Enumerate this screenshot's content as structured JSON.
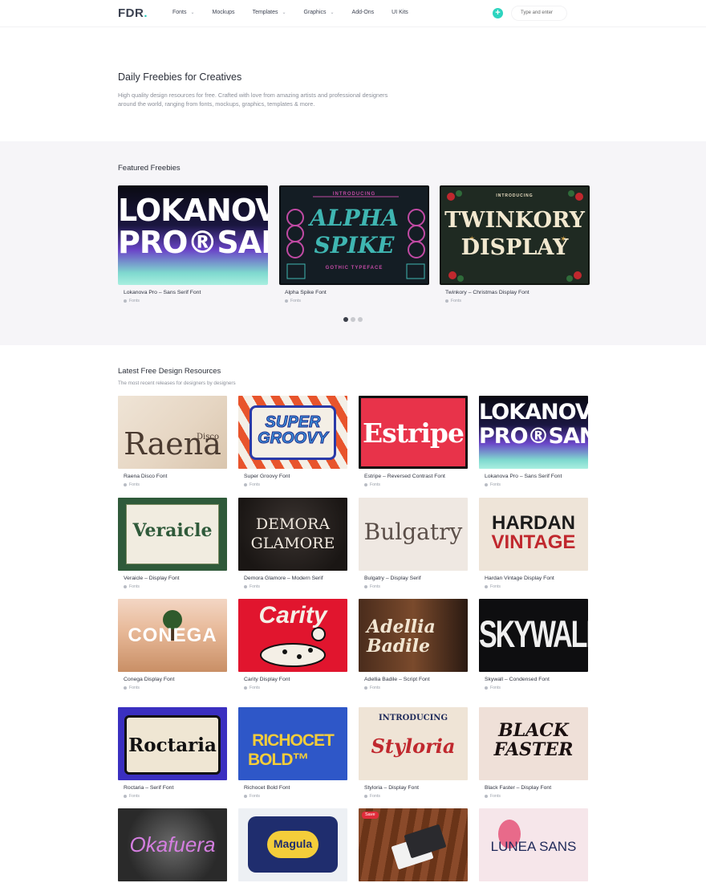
{
  "header": {
    "logo_text": "FDR",
    "logo_dot": ".",
    "nav": [
      {
        "label": "Fonts",
        "has_dropdown": true
      },
      {
        "label": "Mockups",
        "has_dropdown": false
      },
      {
        "label": "Templates",
        "has_dropdown": true
      },
      {
        "label": "Graphics",
        "has_dropdown": true
      },
      {
        "label": "Add-Ons",
        "has_dropdown": false
      },
      {
        "label": "UI Kits",
        "has_dropdown": false
      }
    ],
    "add_icon": "+",
    "search_placeholder": "Type and enter"
  },
  "hero": {
    "title": "Daily Freebies for Creatives",
    "description": "High quality design resources for free. Crafted with love from amazing artists and professional designers around the world, ranging from fonts, mockups, graphics, templates & more."
  },
  "featured": {
    "title": "Featured Freebies",
    "cards": [
      {
        "title": "Lokanova Pro – Sans Serif Font",
        "category": "Fonts",
        "art": [
          "LOKANOVA",
          "PRO®SANS"
        ]
      },
      {
        "title": "Alpha Spike Font",
        "category": "Fonts",
        "art": [
          "INTRODUCING",
          "ALPHA",
          "SPIKE",
          "GOTHIC TYPEFACE"
        ]
      },
      {
        "title": "Twinkory – Christmas Display Font",
        "category": "Fonts",
        "art": [
          "INTRODUCING",
          "TWINKORY",
          "DISPLAY"
        ]
      }
    ],
    "pagination": {
      "count": 3,
      "active": 1
    }
  },
  "latest": {
    "title": "Latest Free Design Resources",
    "subtitle": "The most recent releases for designers by designers",
    "items": [
      {
        "title": "Raena Disco Font",
        "category": "Fonts",
        "art": [
          "Raena",
          "Disco"
        ]
      },
      {
        "title": "Super Groovy Font",
        "category": "Fonts",
        "art": [
          "SUPER",
          "GROOVY"
        ]
      },
      {
        "title": "Estripe – Reversed Contrast Font",
        "category": "Fonts",
        "art": [
          "Estripe"
        ]
      },
      {
        "title": "Lokanova Pro – Sans Serif Font",
        "category": "Fonts",
        "art": [
          "LOKANOVA",
          "PRO®SANS"
        ]
      },
      {
        "title": "Veraicle – Display Font",
        "category": "Fonts",
        "art": [
          "Veraicle"
        ]
      },
      {
        "title": "Demora Glamore – Modern Serif",
        "category": "Fonts",
        "art": [
          "DEMORA",
          "GLAMORE"
        ]
      },
      {
        "title": "Bulgatry – Display Serif",
        "category": "Fonts",
        "art": [
          "Bulgatry"
        ]
      },
      {
        "title": "Hardan Vintage Display Font",
        "category": "Fonts",
        "art": [
          "HARDAN",
          "VINTAGE"
        ]
      },
      {
        "title": "Conega Display Font",
        "category": "Fonts",
        "art": [
          "CONEGA"
        ]
      },
      {
        "title": "Carity Display Font",
        "category": "Fonts",
        "art": [
          "Carity"
        ]
      },
      {
        "title": "Adellia Badile – Script Font",
        "category": "Fonts",
        "art": [
          "Adellia",
          "Badile"
        ]
      },
      {
        "title": "Skywall – Condensed Font",
        "category": "Fonts",
        "art": [
          "SKYWALL"
        ]
      },
      {
        "title": "Roctaria – Serif Font",
        "category": "Fonts",
        "art": [
          "Roctaria"
        ]
      },
      {
        "title": "Richocet Bold Font",
        "category": "Fonts",
        "art": [
          "RICHOCET",
          "BOLD™"
        ]
      },
      {
        "title": "Styloria – Display Font",
        "category": "Fonts",
        "art": [
          "INTRODUCING",
          "Styloria"
        ]
      },
      {
        "title": "Black Faster – Display Font",
        "category": "Fonts",
        "art": [
          "BLACK",
          "FASTER"
        ]
      },
      {
        "title": "",
        "category": "",
        "art": [
          "Okafuera"
        ]
      },
      {
        "title": "",
        "category": "",
        "art": [
          "Magula"
        ]
      },
      {
        "title": "",
        "category": "",
        "art": [
          "Save"
        ]
      },
      {
        "title": "",
        "category": "",
        "art": [
          "LUNEA SANS"
        ]
      }
    ]
  },
  "colors": {
    "accent": "#2dd4bf",
    "featured_bg": "#f6f5f8",
    "text_dark": "#2a2e38",
    "text_muted": "#8b8f99"
  }
}
